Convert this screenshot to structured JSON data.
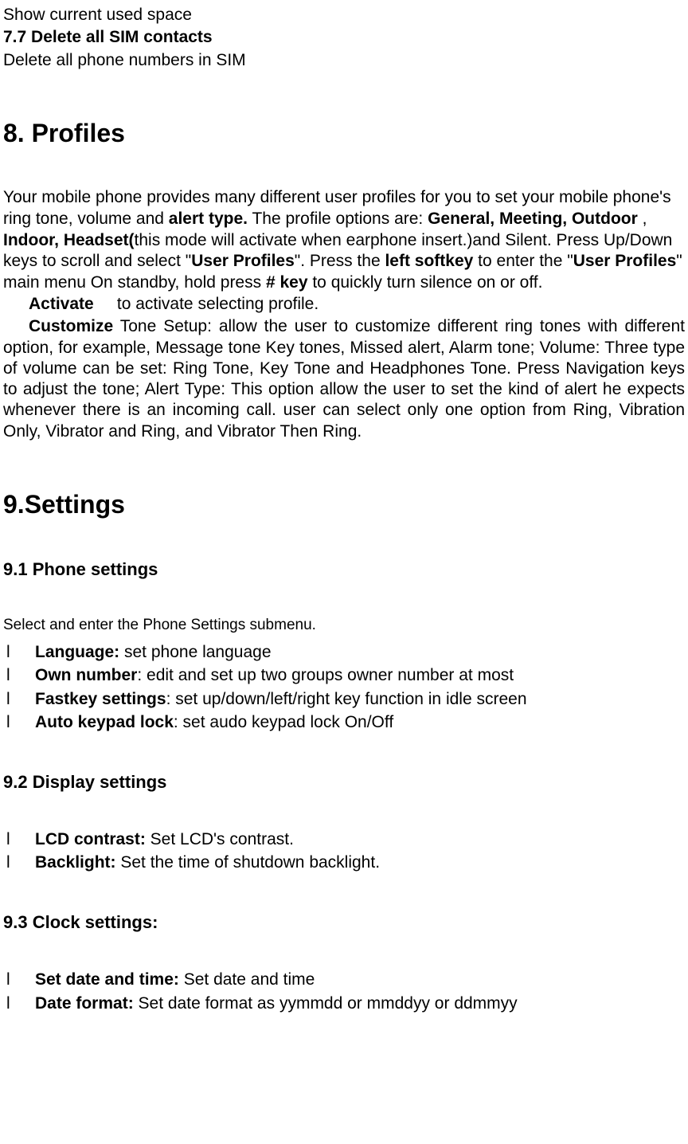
{
  "top": {
    "show_space": "Show current used space",
    "h77": "7.7 Delete all SIM contacts",
    "delete_sim": "Delete all phone numbers in SIM"
  },
  "profiles": {
    "heading": "8. Profiles",
    "p1_a": "Your mobile phone provides many different user profiles for you to set your mobile phone's ring tone, volume and ",
    "p1_b_alert": "alert type.",
    "p1_c": " The profile options are: ",
    "p1_general": "General, Meeting, Outdoor",
    "p1_comma": " , ",
    "p1_indoor": "Indoor, Headset(",
    "p1_d": "this mode will activate when earphone insert.)and Silent. Press Up/Down keys to scroll and select \"",
    "p1_user_profiles": "User Profiles",
    "p1_e": "\". Press the ",
    "p1_left_softkey": "left softkey",
    "p1_f": " to enter the \"",
    "p1_user_profiles2": "User Profiles",
    "p1_g": "\" main menu On standby, hold press ",
    "p1_hashkey": "# key",
    "p1_h": " to quickly turn silence on or off.",
    "activate_label": "Activate",
    "activate_gap": "     ",
    "activate_text": "to activate selecting profile.",
    "customize_label": "Customize",
    "customize_text": " Tone Setup: allow the user to customize different ring tones with different option, for example, Message tone Key tones, Missed alert, Alarm tone; Volume: Three type of volume can be set: Ring Tone, Key Tone and Headphones Tone. Press Navigation keys to adjust the tone; Alert Type: This option allow the user to set the kind of alert he expects whenever there is an incoming call. user can select only one option from Ring, Vibration Only, Vibrator and Ring, and Vibrator Then Ring."
  },
  "settings": {
    "heading": "9.Settings",
    "s91": {
      "heading": "9.1 Phone settings",
      "intro": "Select and enter the Phone Settings submenu.",
      "items": [
        {
          "label": "Language:",
          "text": " set phone language"
        },
        {
          "label": "Own number",
          "text": ": edit and set up two groups owner number at most"
        },
        {
          "label": "Fastkey settings",
          "text": ": set up/down/left/right key function in idle screen"
        },
        {
          "label": "Auto keypad lock",
          "text": ": set audo keypad lock On/Off"
        }
      ]
    },
    "s92": {
      "heading": "9.2 Display settings",
      "items": [
        {
          "label": "LCD contrast:",
          "text": " Set LCD's contrast."
        },
        {
          "label": "Backlight:",
          "text": " Set the time of shutdown backlight."
        }
      ]
    },
    "s93": {
      "heading": "9.3 Clock settings:",
      "items": [
        {
          "label": "Set date and time:",
          "text": " Set date and time"
        },
        {
          "label": "Date format:",
          "text": " Set date format as yymmdd or mmddyy or ddmmyy"
        }
      ]
    }
  },
  "bullet": "l"
}
